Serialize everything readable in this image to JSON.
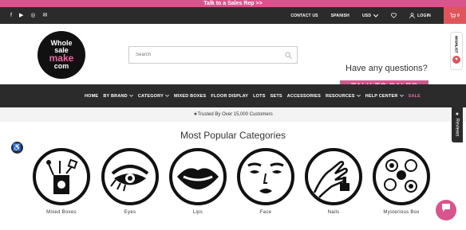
{
  "promo": {
    "text": "Talk to a Sales Rep >>"
  },
  "topbar": {
    "social": [
      "f",
      "▶",
      "◎",
      "✉"
    ],
    "contact": "CONTACT US",
    "language": "SPANISH",
    "currency": "USD",
    "login": "LOGIN",
    "cart_count": "0"
  },
  "logo": {
    "line1": "Whole",
    "line2": "sale",
    "line3": "make",
    "line4": "com"
  },
  "search": {
    "placeholder": "Search"
  },
  "header": {
    "questions": "Have any questions?",
    "talk": "TALK TO SALES"
  },
  "nav": {
    "items": [
      "HOME",
      "BY BRAND",
      "CATEGORY",
      "MIXED BOXES",
      "FLOOR DISPLAY",
      "LOTS",
      "SETS",
      "ACCESSORIES",
      "RESOURCES",
      "HELP CENTER",
      "SALE"
    ]
  },
  "trust": {
    "text": "Trusted By Over 15,000 Customers"
  },
  "categories": {
    "heading": "Most Popular Categories",
    "items": [
      "Mixed Boxes",
      "Eyes",
      "Lips",
      "Face",
      "Nails",
      "Mysterious Box"
    ]
  },
  "sidebar": {
    "wishlist": "WISHLIST",
    "reviews": "Reviews"
  }
}
